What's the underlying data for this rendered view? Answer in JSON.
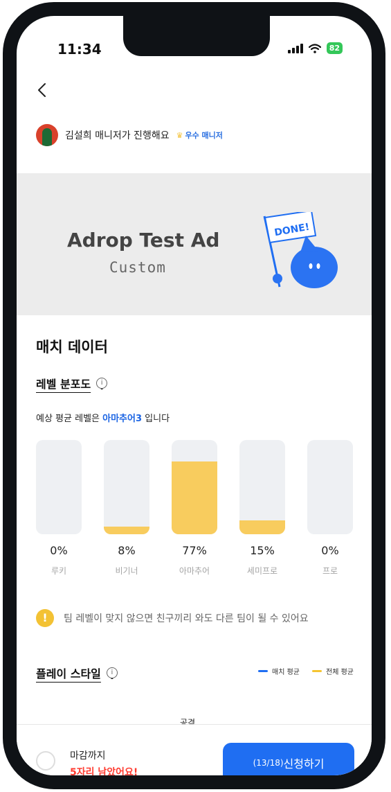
{
  "status_bar": {
    "time": "11:34",
    "battery": "82"
  },
  "manager": {
    "text": "김설희 매니저가 진행해요",
    "badge": "우수 매니저"
  },
  "banner": {
    "title": "Adrop Test Ad",
    "subtitle": "Custom",
    "flag_text": "DONE!"
  },
  "match_data": {
    "title": "매치 데이터",
    "level_title": "레벨 분포도",
    "level_desc_prefix": "예상 평균 레벨은 ",
    "level_desc_highlight": "아마추어3",
    "level_desc_suffix": " 입니다"
  },
  "chart_data": {
    "type": "bar",
    "categories": [
      "루키",
      "비기너",
      "아마추어",
      "세미프로",
      "프로"
    ],
    "values": [
      0,
      8,
      77,
      15,
      0
    ],
    "value_labels": [
      "0%",
      "8%",
      "77%",
      "15%",
      "0%"
    ],
    "ylim": [
      0,
      100
    ]
  },
  "notice": {
    "text": "팀 레벨이 맞지 않으면 친구끼리 와도 다른 팀이 될 수 있어요"
  },
  "play_style": {
    "title": "플레이 스타일",
    "legend": [
      {
        "label": "매치 평균",
        "color": "#1f6ef2"
      },
      {
        "label": "전체 평균",
        "color": "#f5c531"
      }
    ],
    "axis_label": "공격"
  },
  "bottom": {
    "deadline_label": "마감까지",
    "seats_left": "5자리 남았어요!",
    "apply_count": "(13/18)",
    "apply_label": "신청하기"
  },
  "colors": {
    "accent": "#1f6ef2",
    "bar": "#f8cc5e",
    "warning": "#ff3b30"
  }
}
